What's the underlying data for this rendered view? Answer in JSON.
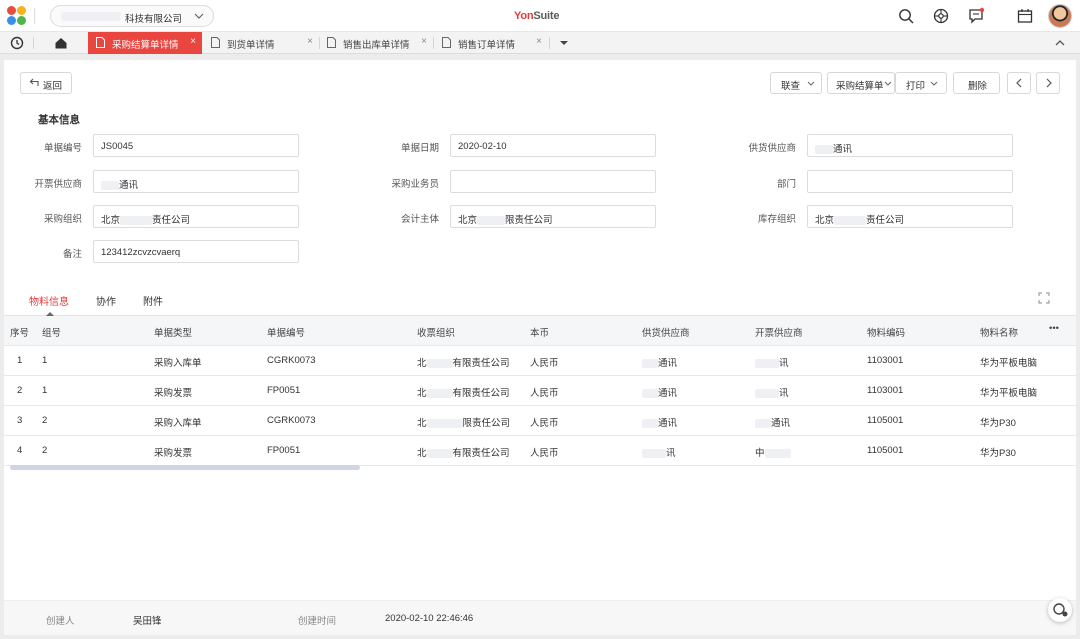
{
  "header": {
    "company_name": "科技有限公司",
    "brand_main": "Yon",
    "brand_sub": "Suite"
  },
  "tabs": [
    {
      "label": "采购结算单详情",
      "active": true
    },
    {
      "label": "到货单详情",
      "active": false
    },
    {
      "label": "销售出库单详情",
      "active": false
    },
    {
      "label": "销售订单详情",
      "active": false
    }
  ],
  "toolbar": {
    "back": "返回",
    "link": "联查",
    "settle": "采购结算单",
    "print": "打印",
    "delete": "删除"
  },
  "section_title": "基本信息",
  "form": {
    "doc_no_label": "单据编号",
    "doc_no": "JS0045",
    "doc_date_label": "单据日期",
    "doc_date": "2020-02-10",
    "supplier_label": "供货供应商",
    "supplier": "通讯",
    "invoice_supplier_label": "开票供应商",
    "invoice_supplier": "通讯",
    "buyer_label": "采购业务员",
    "buyer": "",
    "dept_label": "部门",
    "dept": "",
    "purchase_org_label": "采购组织",
    "purchase_org_prefix": "北京",
    "purchase_org_suffix": "责任公司",
    "accounting_label": "会计主体",
    "accounting_prefix": "北京",
    "accounting_suffix": "限责任公司",
    "stock_org_label": "库存组织",
    "stock_org_prefix": "北京",
    "stock_org_suffix": "责任公司",
    "remark_label": "备注",
    "remark": "123412zcvzcvaerq"
  },
  "subtabs": [
    "物料信息",
    "协作",
    "附件"
  ],
  "grid": {
    "columns": [
      "序号",
      "组号",
      "单据类型",
      "单据编号",
      "收票组织",
      "本币",
      "供货供应商",
      "开票供应商",
      "物料编码",
      "物料名称"
    ],
    "more": "•••",
    "rows": [
      {
        "seq": "1",
        "group": "1",
        "type": "采购入库单",
        "no": "CGRK0073",
        "org_a": "北",
        "org_b": "有限责任公司",
        "cur": "人民币",
        "sup": "通讯",
        "inv": "讯",
        "code": "1103001",
        "name": "华为平板电脑"
      },
      {
        "seq": "2",
        "group": "1",
        "type": "采购发票",
        "no": "FP0051",
        "org_a": "北",
        "org_b": "有限责任公司",
        "cur": "人民币",
        "sup": "通讯",
        "inv": "讯",
        "code": "1103001",
        "name": "华为平板电脑"
      },
      {
        "seq": "3",
        "group": "2",
        "type": "采购入库单",
        "no": "CGRK0073",
        "org_a": "北",
        "org_b": "限责任公司",
        "cur": "人民币",
        "sup": "通讯",
        "inv": "通讯",
        "code": "1105001",
        "name": "华为P30"
      },
      {
        "seq": "4",
        "group": "2",
        "type": "采购发票",
        "no": "FP0051",
        "org_a": "北",
        "org_b": "有限责任公司",
        "cur": "人民币",
        "sup": "讯",
        "inv": "中",
        "code": "1105001",
        "name": "华为P30"
      }
    ]
  },
  "footer": {
    "creator_label": "创建人",
    "creator": "吴田锋",
    "created_label": "创建时间",
    "created": "2020-02-10 22:46:46"
  },
  "colors": {
    "accent": "#e9463f",
    "brand": "#e23b3b"
  }
}
